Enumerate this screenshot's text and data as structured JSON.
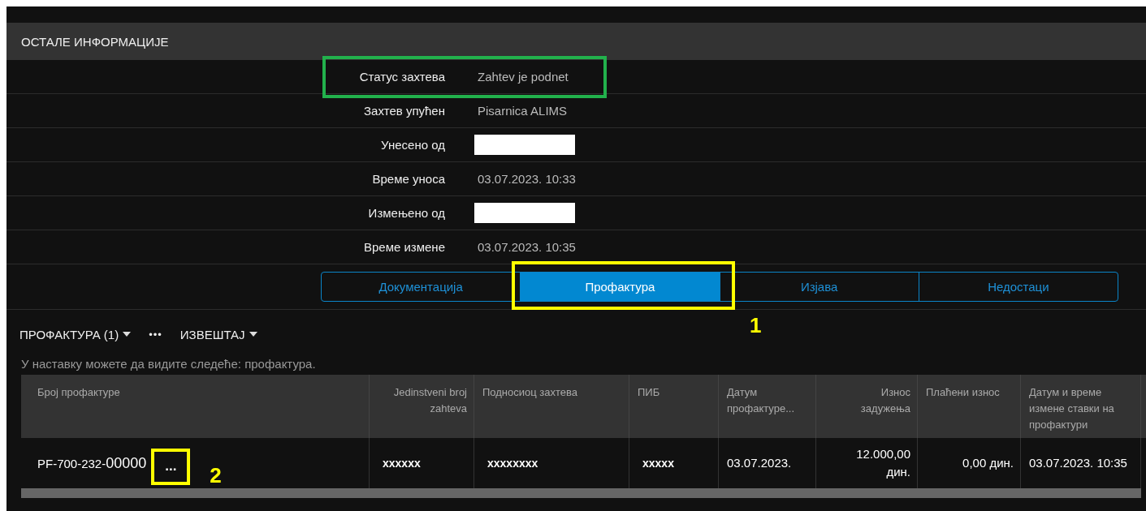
{
  "section": {
    "title": "ОСТАЛЕ ИНФОРМАЦИЈЕ"
  },
  "info_rows": [
    {
      "label": "Статус захтева",
      "value": "Zahtev je podnet",
      "redacted": false,
      "highlight": {
        "color": "#22b14c"
      }
    },
    {
      "label": "Захтев упућен",
      "value": "Pisarnica ALIMS",
      "redacted": false
    },
    {
      "label": "Унесено од",
      "redacted": true
    },
    {
      "label": "Време уноса",
      "value": "03.07.2023. 10:33",
      "redacted": false
    },
    {
      "label": "Измењено од",
      "redacted": true
    },
    {
      "label": "Време измене",
      "value": "03.07.2023. 10:35",
      "redacted": false
    }
  ],
  "tabs": [
    {
      "label": "Документација",
      "selected": false
    },
    {
      "label": "Профактура",
      "selected": true,
      "highlight": {
        "color": "#ffff00",
        "label": "1"
      }
    },
    {
      "label": "Изјава",
      "selected": false
    },
    {
      "label": "Недостаци",
      "selected": false
    }
  ],
  "toolbar": {
    "menu": "ПРОФАКТУРА (1)",
    "more": "•••",
    "report": "ИЗВЕШТАЈ"
  },
  "description": "У наставку можете да видите следеће: профактура.",
  "table": {
    "columns": [
      "Број профактуре",
      "Jedinstveni broj zahteva",
      "Подносиоц захтева",
      "ПИБ",
      "Датум профактуре...",
      "Износ задужења",
      "Плаћени износ",
      "Датум и време измене ставки на профактури"
    ],
    "rows": [
      {
        "cells": [
          {
            "prefix": "PF-700-232-",
            "number": "00000",
            "actions": "...",
            "actions_highlight": {
              "color": "#ffff00",
              "label": "2"
            }
          },
          "xxxxxx",
          "xxxxxxxx",
          "xxxxx",
          "03.07.2023.",
          "12.000,00 дин.",
          "0,00 дин.",
          "03.07.2023. 10:35"
        ]
      }
    ]
  }
}
